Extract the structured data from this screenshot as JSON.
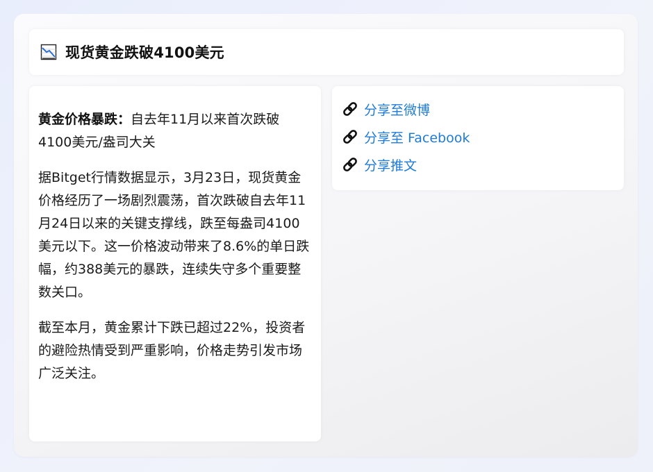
{
  "header": {
    "icon": "chart-decreasing-icon",
    "title": "现货黄金跌破4100美元"
  },
  "article": {
    "lead_bold": "黄金价格暴跌：",
    "lead_text": "自去年11月以来首次跌破4100美元/盎司大关",
    "paragraph_2": "据Bitget行情数据显示，3月23日，现货黄金价格经历了一场剧烈震荡，首次跌破自去年11月24日以来的关键支撑线，跌至每盎司4100美元以下。这一价格波动带来了8.6%的单日跌幅，约388美元的暴跌，连续失守多个重要整数关口。",
    "paragraph_3": "截至本月，黄金累计下跌已超过22%，投资者的避险热情受到严重影响，价格走势引发市场广泛关注。"
  },
  "share": {
    "icon": "link-icon",
    "link_color": "#1e7bd8",
    "items": [
      {
        "label": "分享至微博"
      },
      {
        "label": "分享至 Facebook"
      },
      {
        "label": "分享推文"
      }
    ]
  }
}
